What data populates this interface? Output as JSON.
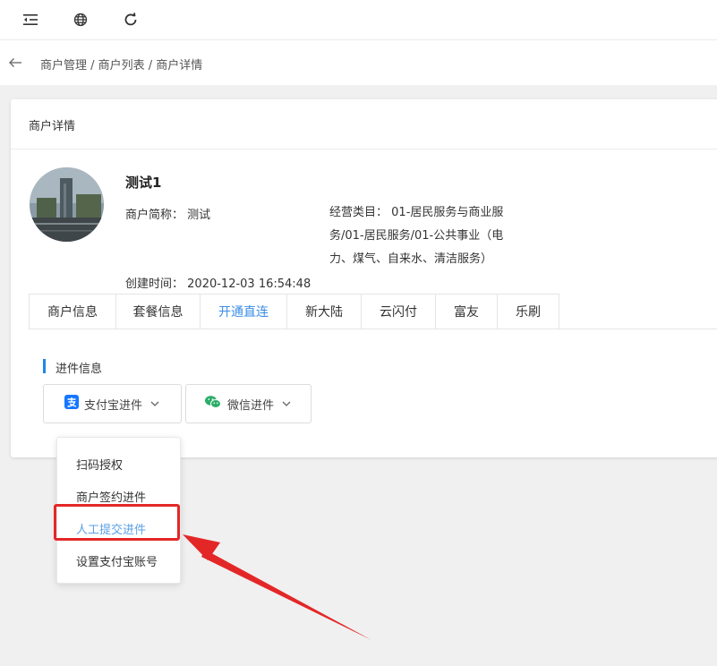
{
  "topbar": {
    "icons": [
      "menu-fold-icon",
      "globe-icon",
      "refresh-icon"
    ]
  },
  "breadcrumb": {
    "back_icon": "arrow-left-icon",
    "text": "商户管理 / 商户列表 / 商户详情"
  },
  "card": {
    "title": "商户详情"
  },
  "merchant": {
    "name": "测试1",
    "short_name_label": "商户简称：",
    "short_name": "测试",
    "category_label": "经营类目：",
    "category": "01-居民服务与商业服务/01-居民服务/01-公共事业（电力、煤气、自来水、清洁服务）",
    "created_label": "创建时间：",
    "created": "2020-12-03 16:54:48"
  },
  "tabs": [
    {
      "label": "商户信息",
      "active": false
    },
    {
      "label": "套餐信息",
      "active": false
    },
    {
      "label": "开通直连",
      "active": true
    },
    {
      "label": "新大陆",
      "active": false
    },
    {
      "label": "云闪付",
      "active": false
    },
    {
      "label": "富友",
      "active": false
    },
    {
      "label": "乐刷",
      "active": false
    }
  ],
  "section": {
    "title": "进件信息"
  },
  "buttons": {
    "alipay": {
      "label": "支付宝进件",
      "icon": "alipay-icon"
    },
    "wechat": {
      "label": "微信进件",
      "icon": "wechat-icon"
    }
  },
  "menu": {
    "items": [
      "扫码授权",
      "商户签约进件",
      "人工提交进件",
      "设置支付宝账号"
    ],
    "highlighted_index": 2
  },
  "colors": {
    "accent": "#3a8ee6",
    "highlight_red": "#e32727",
    "section_bar": "#1e88e5",
    "alipay_blue": "#1677ff",
    "wechat_green": "#2aae67"
  }
}
